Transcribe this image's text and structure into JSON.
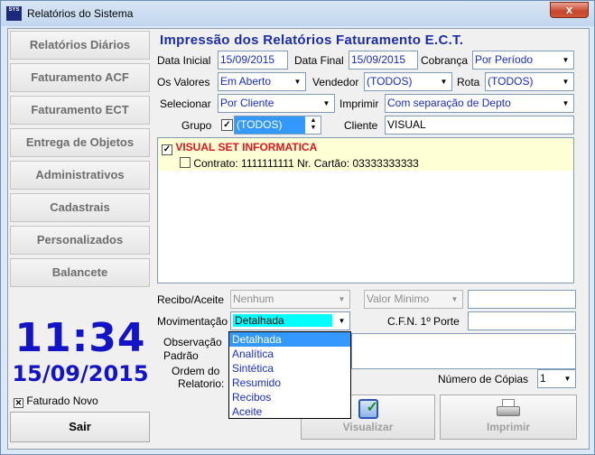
{
  "window": {
    "title": "Relatórios do Sistema",
    "close_glyph": "x",
    "app_icon_text": "SYS"
  },
  "sidebar": {
    "items": [
      {
        "label": "Relatórios Diários"
      },
      {
        "label": "Faturamento ACF"
      },
      {
        "label": "Faturamento ECT"
      },
      {
        "label": "Entrega de Objetos"
      },
      {
        "label": "Administrativos"
      },
      {
        "label": "Cadastrais"
      },
      {
        "label": "Personalizados"
      },
      {
        "label": "Balancete"
      }
    ],
    "clock_time": "11:34",
    "clock_date": "15/09/2015",
    "faturado_novo_label": "Faturado Novo",
    "sair_label": "Sair"
  },
  "form": {
    "title": "Impressão dos Relatórios Faturamento E.C.T.",
    "data_inicial_label": "Data Inicial",
    "data_inicial_value": "15/09/2015",
    "data_final_label": "Data Final",
    "data_final_value": "15/09/2015",
    "cobranca_label": "Cobrança",
    "cobranca_value": "Por Período",
    "os_valores_label": "Os Valores",
    "os_valores_value": "Em Aberto",
    "vendedor_label": "Vendedor",
    "vendedor_value": "(TODOS)",
    "rota_label": "Rota",
    "rota_value": "(TODOS)",
    "selecionar_label": "Selecionar",
    "selecionar_value": "Por Cliente",
    "imprimir_label": "Imprimir",
    "imprimir_value": "Com separação de Depto",
    "grupo_label": "Grupo",
    "grupo_value": "(TODOS)",
    "cliente_label": "Cliente",
    "cliente_value": "VISUAL"
  },
  "tree": {
    "client_name": "VISUAL SET INFORMATICA",
    "contract_text": "Contrato:  1111111111 Nr. Cartão: 03333333333"
  },
  "options": {
    "recibo_label": "Recibo/Aceite",
    "recibo_value": "Nenhum",
    "valor_minimo_value": "Valor Minimo",
    "movimentacao_label": "Movimentação",
    "movimentacao_value": "Detalhada",
    "cfn_label": "C.F.N. 1º Porte",
    "observacao_label": "Observação",
    "padrao_label": "Padrão",
    "ordem_label": "Ordem do",
    "relatorio_label": "Relatorio:",
    "copias_label": "Número de Cópias",
    "copias_value": "1"
  },
  "movimentacao_options": [
    {
      "label": "Detalhada"
    },
    {
      "label": "Analítica"
    },
    {
      "label": "Sintética"
    },
    {
      "label": "Resumido"
    },
    {
      "label": "Recibos"
    },
    {
      "label": "Aceite"
    }
  ],
  "actions": {
    "visualizar_label": "Visualizar",
    "imprimir_label": "Imprimir"
  },
  "colors": {
    "accent_blue": "#1313c8",
    "title_blue": "#1c2cab",
    "highlight": "#00ffff",
    "tree_bg": "#ffffd6",
    "tree_head": "#e2141e",
    "selection": "#3399ff"
  }
}
